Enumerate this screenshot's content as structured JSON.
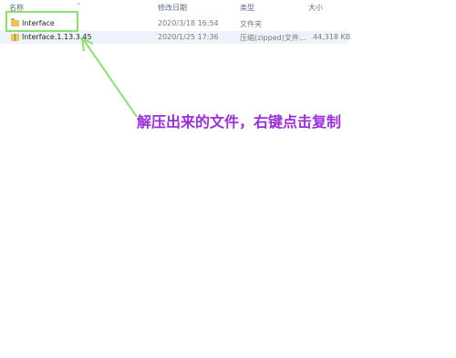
{
  "header": {
    "name": "名称",
    "date": "修改日期",
    "type": "类型",
    "size": "大小"
  },
  "files": [
    {
      "name": "Interface",
      "date": "2020/3/18 16:54",
      "type": "文件夹",
      "size": "",
      "icon": "folder-icon"
    },
    {
      "name": "Interface.1.13.3.45",
      "date": "2020/1/25 17:36",
      "type": "压缩(zipped)文件...",
      "size": "44,318 KB",
      "icon": "zip-icon"
    }
  ],
  "annotation": {
    "text": "解压出来的文件，右键点击复制",
    "color": "#9b2fe0"
  },
  "highlight_color": "#8ee06e",
  "arrow_color": "#8ee06e"
}
